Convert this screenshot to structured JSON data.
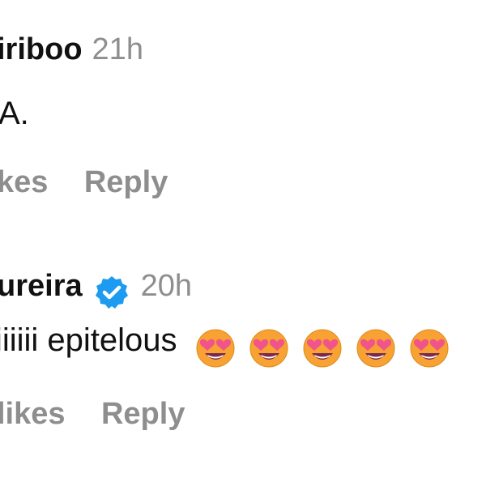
{
  "comments": [
    {
      "username": "iriboo",
      "timestamp": "21h",
      "text": "A.",
      "likes_label": "kes",
      "reply_label": "Reply",
      "verified": false
    },
    {
      "username": "ureira",
      "timestamp": "20h",
      "text": "iiiiii epitelous",
      "likes_label": "likes",
      "reply_label": "Reply",
      "verified": true,
      "emojis": [
        "heart-eyes-emoji",
        "heart-eyes-emoji",
        "heart-eyes-emoji",
        "heart-eyes-emoji",
        "heart-eyes-emoji"
      ]
    }
  ],
  "colors": {
    "text": "#111111",
    "muted": "#8e8e8e",
    "verified_blue": "#1d9bf0",
    "emoji_face": "#f7a233",
    "emoji_heart": "#f0548a"
  }
}
